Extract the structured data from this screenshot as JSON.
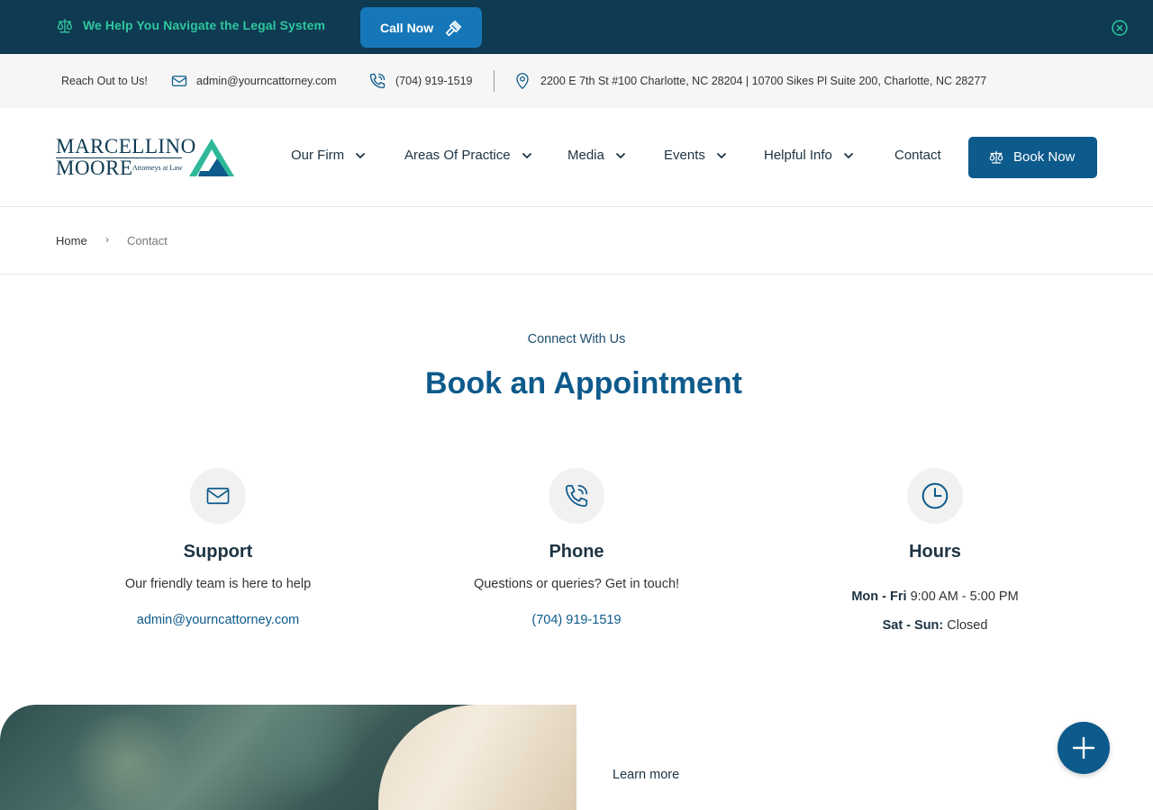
{
  "banner": {
    "tagline": "We Help You Navigate the Legal System",
    "call_button": "Call Now",
    "icons": [
      "scales-icon",
      "gavel-icon",
      "close-icon"
    ]
  },
  "info_bar": {
    "reach_label": "Reach Out to Us!",
    "email": "admin@yourncattorney.com",
    "phone": "(704) 919-1519",
    "address": "2200 E 7th St #100 Charlotte, NC 28204 | 10700 Sikes Pl Suite 200, Charlotte, NC 28277",
    "icons": [
      "mail-icon",
      "phone-icon",
      "location-pin-icon"
    ]
  },
  "logo": {
    "line1": "MARCELLINO",
    "line2": "MOORE",
    "subtitle": "Attorneys at Law"
  },
  "nav": {
    "items": [
      {
        "label": "Our Firm",
        "has_dropdown": true
      },
      {
        "label": "Areas Of Practice",
        "has_dropdown": true
      },
      {
        "label": "Media",
        "has_dropdown": true
      },
      {
        "label": "Events",
        "has_dropdown": true
      },
      {
        "label": "Helpful Info",
        "has_dropdown": true
      },
      {
        "label": "Contact",
        "has_dropdown": false
      }
    ],
    "book_now": "Book Now"
  },
  "breadcrumb": {
    "home": "Home",
    "separator": "›",
    "current": "Contact"
  },
  "section": {
    "eyebrow": "Connect With Us",
    "title": "Book an Appointment"
  },
  "cards": {
    "support": {
      "icon": "mail-icon",
      "title": "Support",
      "description": "Our friendly team is here to help",
      "link": "admin@yourncattorney.com"
    },
    "phone": {
      "icon": "phone-icon",
      "title": "Phone",
      "description": "Questions or queries? Get in touch!",
      "link": "(704) 919-1519"
    },
    "hours": {
      "icon": "clock-icon",
      "title": "Hours",
      "weekday_label": "Mon - Fri",
      "weekday_value": "9:00 AM - 5:00 PM",
      "weekend_label": "Sat - Sun:",
      "weekend_value": "Closed"
    }
  },
  "bottom": {
    "learn_more": "Learn more",
    "fab_icon": "plus-icon"
  },
  "colors": {
    "banner_bg": "#0e3a52",
    "banner_accent": "#2fc79c",
    "primary": "#0d5a8c",
    "call_button": "#1677b8"
  }
}
